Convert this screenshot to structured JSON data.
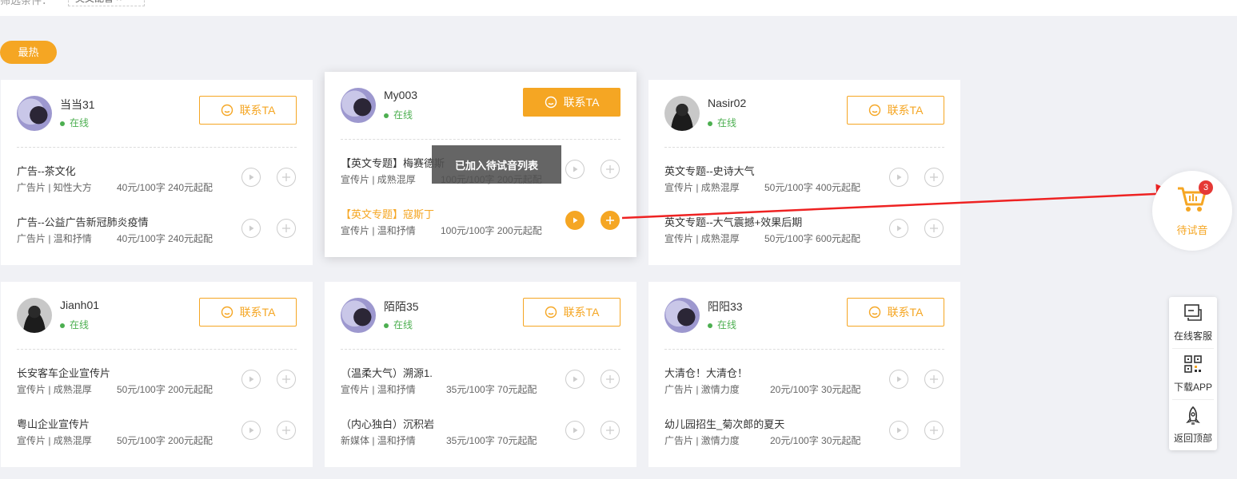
{
  "header": {
    "filter_label": "筛选条件：",
    "filter_chip": "英文配音 ×"
  },
  "section_tag": "最热",
  "cards": [
    {
      "name": "当当31",
      "status": "在线",
      "contact": "联系TA",
      "tracks": [
        {
          "title": "广告--茶文化",
          "meta": "广告片 | 知性大方",
          "price": "40元/100字 240元起配"
        },
        {
          "title": "广告--公益广告新冠肺炎疫情",
          "meta": "广告片 | 温和抒情",
          "price": "40元/100字 240元起配"
        }
      ]
    },
    {
      "name": "My003",
      "status": "在线",
      "contact": "联系TA",
      "tracks": [
        {
          "title": "【英文专题】梅赛德斯",
          "meta": "宣传片 | 成熟混厚",
          "price": "100元/100字 200元起配"
        },
        {
          "title": "【英文专题】寇斯丁",
          "meta": "宣传片 | 温和抒情",
          "price": "100元/100字 200元起配"
        }
      ]
    },
    {
      "name": "Nasir02",
      "status": "在线",
      "contact": "联系TA",
      "tracks": [
        {
          "title": "英文专题--史诗大气",
          "meta": "宣传片 | 成熟混厚",
          "price": "50元/100字 400元起配"
        },
        {
          "title": "英文专题--大气震撼+效果后期",
          "meta": "宣传片 | 成熟混厚",
          "price": "50元/100字 600元起配"
        }
      ]
    },
    {
      "name": "Jianh01",
      "status": "在线",
      "contact": "联系TA",
      "tracks": [
        {
          "title": "长安客车企业宣传片",
          "meta": "宣传片 | 成熟混厚",
          "price": "50元/100字 200元起配"
        },
        {
          "title": "粤山企业宣传片",
          "meta": "宣传片 | 成熟混厚",
          "price": "50元/100字 200元起配"
        }
      ]
    },
    {
      "name": "陌陌35",
      "status": "在线",
      "contact": "联系TA",
      "tracks": [
        {
          "title": "（温柔大气）溯源1.",
          "meta": "宣传片 | 温和抒情",
          "price": "35元/100字 70元起配"
        },
        {
          "title": "（内心独白）沉积岩",
          "meta": "新媒体 | 温和抒情",
          "price": "35元/100字 70元起配"
        }
      ]
    },
    {
      "name": "阳阳33",
      "status": "在线",
      "contact": "联系TA",
      "tracks": [
        {
          "title": "大清仓！大清仓！",
          "meta": "广告片 | 激情力度",
          "price": "20元/100字 30元起配"
        },
        {
          "title": "幼儿园招生_菊次郎的夏天",
          "meta": "广告片 | 激情力度",
          "price": "20元/100字 30元起配"
        }
      ]
    }
  ],
  "toast": "已加入待试音列表",
  "cart": {
    "count": "3",
    "label": "待试音"
  },
  "tools": [
    {
      "label": "在线客服",
      "icon": "chat-icon"
    },
    {
      "label": "下载APP",
      "icon": "qrcode-icon"
    },
    {
      "label": "返回顶部",
      "icon": "rocket-icon"
    }
  ],
  "colors": {
    "accent": "#f5a623",
    "online": "#4caf50",
    "badge": "#e53935",
    "arrow": "#ee2222"
  }
}
